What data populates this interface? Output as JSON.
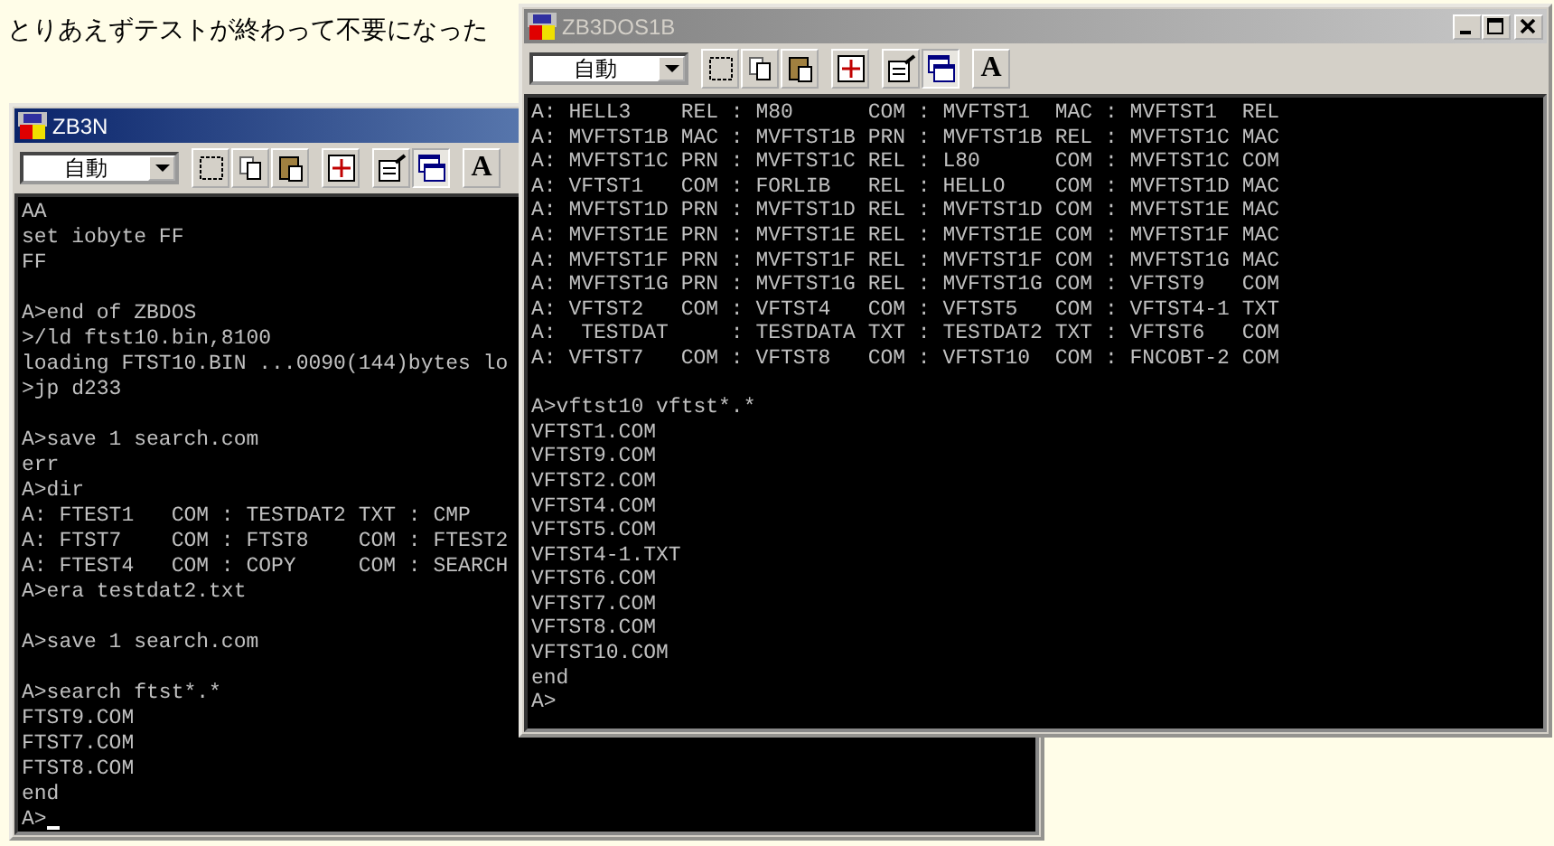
{
  "heading": "とりあえずテストが終わって不要になった",
  "windows": [
    {
      "title": "ZB3N",
      "active": true,
      "cursor": true,
      "toolbar": {
        "font_size": "自動",
        "font_button": "A"
      },
      "blocks": [
        [
          "AA",
          "set iobyte FF",
          "FF"
        ],
        [
          "A>end of ZBDOS",
          ">/ld ftst10.bin,8100",
          "loading FTST10.BIN ...0090(144)bytes lo",
          ">jp d233"
        ],
        [
          "A>save 1 search.com",
          "err",
          "A>dir",
          "A: FTEST1   COM : TESTDAT2 TXT : CMP",
          "A: FTST7    COM : FTST8    COM : FTEST2",
          "A: FTEST4   COM : COPY     COM : SEARCH",
          "A>era testdat2.txt"
        ],
        [
          "A>save 1 search.com"
        ],
        [
          "A>search ftst*.*",
          "FTST9.COM",
          "FTST7.COM",
          "FTST8.COM",
          "end",
          "A>"
        ]
      ]
    },
    {
      "title": "ZB3DOS1B",
      "active": false,
      "window_buttons": true,
      "toolbar": {
        "font_size": "自動",
        "font_button": "A"
      },
      "blocks": [
        [
          "A: HELL3    REL : M80      COM : MVFTST1  MAC : MVFTST1  REL",
          "A: MVFTST1B MAC : MVFTST1B PRN : MVFTST1B REL : MVFTST1C MAC",
          "A: MVFTST1C PRN : MVFTST1C REL : L80      COM : MVFTST1C COM",
          "A: VFTST1   COM : FORLIB   REL : HELLO    COM : MVFTST1D MAC",
          "A: MVFTST1D PRN : MVFTST1D REL : MVFTST1D COM : MVFTST1E MAC",
          "A: MVFTST1E PRN : MVFTST1E REL : MVFTST1E COM : MVFTST1F MAC",
          "A: MVFTST1F PRN : MVFTST1F REL : MVFTST1F COM : MVFTST1G MAC",
          "A: MVFTST1G PRN : MVFTST1G REL : MVFTST1G COM : VFTST9   COM",
          "A: VFTST2   COM : VFTST4   COM : VFTST5   COM : VFTST4-1 TXT",
          "A:  TESTDAT     : TESTDATA TXT : TESTDAT2 TXT : VFTST6   COM",
          "A: VFTST7   COM : VFTST8   COM : VFTST10  COM : FNCOBT-2 COM"
        ],
        [
          "A>vftst10 vftst*.*",
          "VFTST1.COM",
          "VFTST9.COM",
          "VFTST2.COM",
          "VFTST4.COM",
          "VFTST5.COM",
          "VFTST4-1.TXT",
          "VFTST6.COM",
          "VFTST7.COM",
          "VFTST8.COM",
          "VFTST10.COM",
          "end",
          "A>"
        ]
      ]
    }
  ]
}
